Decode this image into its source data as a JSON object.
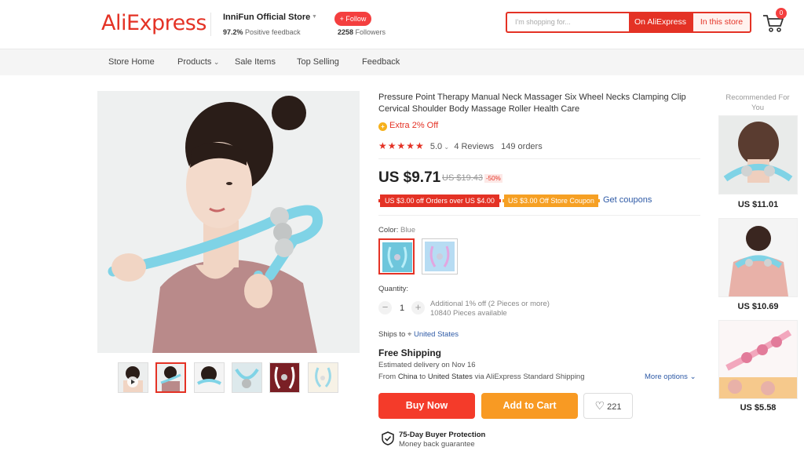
{
  "header": {
    "logo": "AliExpress",
    "store_name": "InniFun Official Store",
    "feedback_pct": "97.2%",
    "feedback_label": "Positive feedback",
    "follow_label": "+ Follow",
    "followers_count": "2258",
    "followers_label": "Followers",
    "search_placeholder": "I'm shopping for...",
    "search_on_ae": "On AliExpress",
    "search_in_store": "In this store",
    "cart_count": "0"
  },
  "nav": {
    "items": [
      "Store Home",
      "Products",
      "Sale Items",
      "Top Selling",
      "Feedback"
    ]
  },
  "product": {
    "title": "Pressure Point Therapy Manual Neck Massager Six Wheel Necks Clamping Clip Cervical Shoulder Body Massage Roller Health Care",
    "extra_off": "Extra 2% Off",
    "rating": "5.0",
    "reviews": "4 Reviews",
    "orders": "149 orders",
    "price": "US $9.71",
    "old_price": "US $19.43",
    "discount": "-50%",
    "coupon_1": "US $3.00 off Orders over US $4.00",
    "coupon_2": "US $3.00 Off Store Coupon",
    "get_coupons": "Get coupons",
    "color_label": "Color:",
    "color_value": "Blue",
    "quantity_label": "Quantity:",
    "quantity": "1",
    "qty_note_1": "Additional 1% off (2 Pieces or more)",
    "qty_note_2": "10840 Pieces available",
    "ships_to_label": "Ships to",
    "ships_to": "United States",
    "free_shipping": "Free Shipping",
    "delivery": "Estimated delivery on Nov 16",
    "from_prefix": "From",
    "from_country": "China",
    "to_prefix": "to",
    "to_country": "United States",
    "via": "via AliExpress Standard Shipping",
    "more_options": "More options",
    "buy_now": "Buy Now",
    "add_to_cart": "Add to Cart",
    "wishlist_count": "221",
    "protection_title": "75-Day Buyer Protection",
    "protection_sub": "Money back guarantee"
  },
  "recommended": {
    "title": "Recommended For You",
    "prices": [
      "US $11.01",
      "US $10.69",
      "US $5.58"
    ]
  },
  "colors": {
    "brand": "#e43225",
    "buy": "#f43b2a",
    "cart": "#f89a23",
    "massager_blue": "#7fd3e6",
    "link": "#2e5aa6"
  }
}
